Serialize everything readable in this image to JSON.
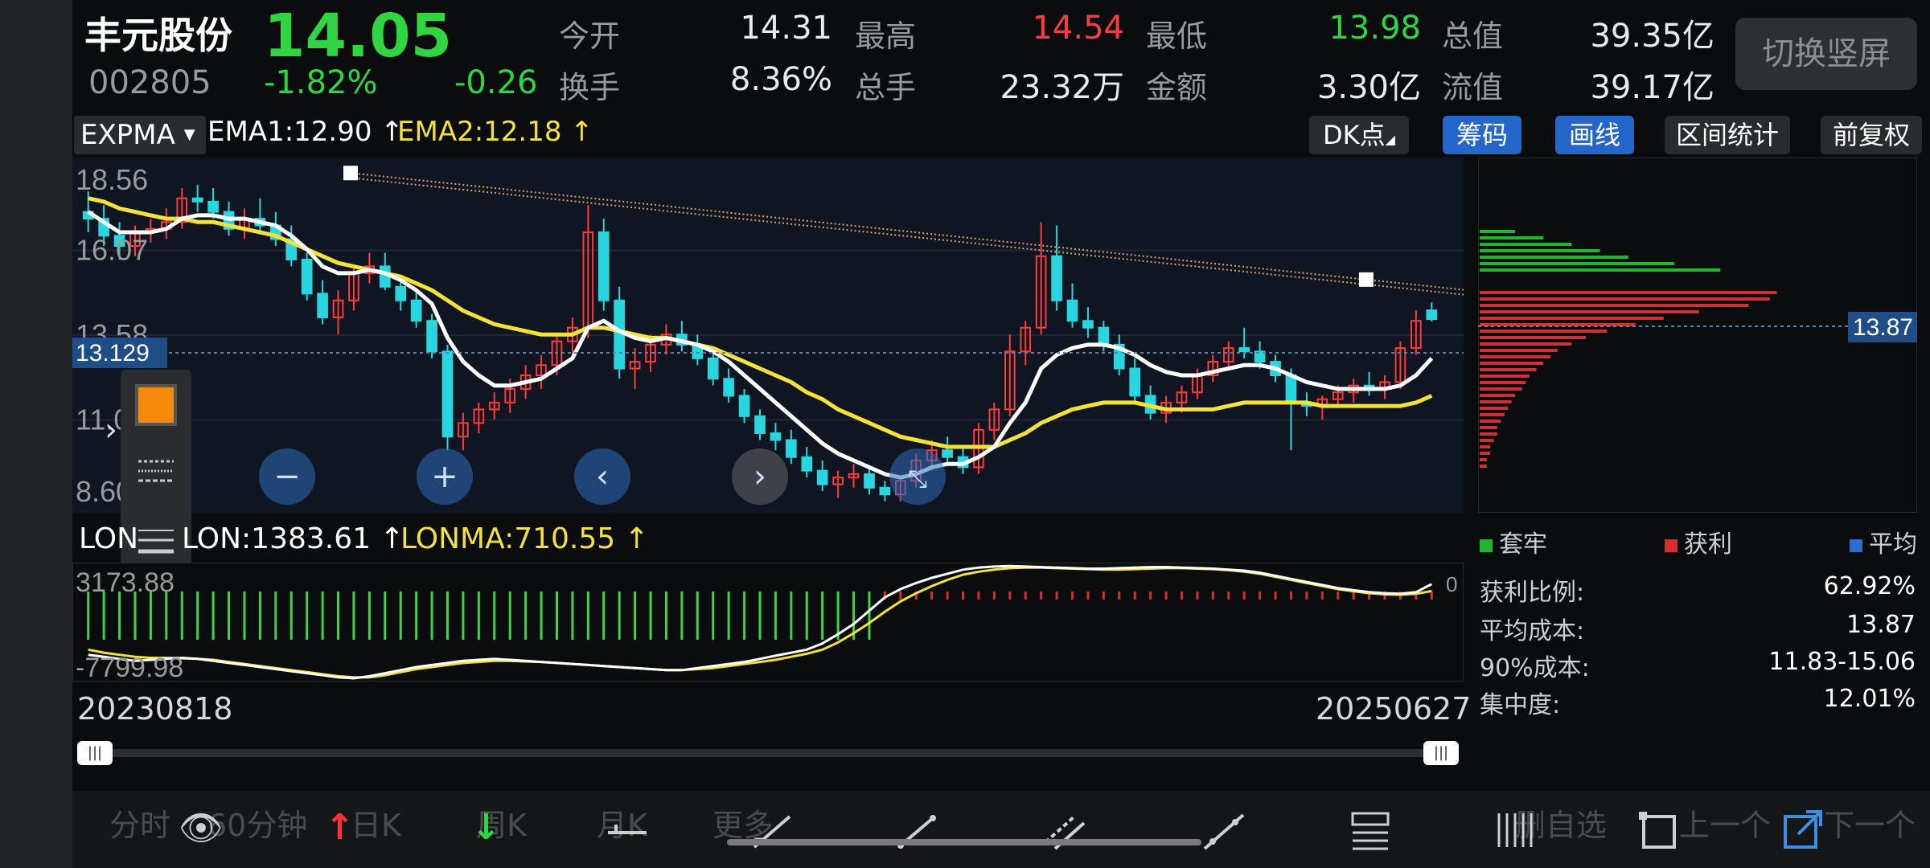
{
  "quote": {
    "name": "丰元股份",
    "code": "002805",
    "price": "14.05",
    "change_pct": "-1.82%",
    "change": "-0.26"
  },
  "stats": [
    {
      "label": "今开",
      "value": "14.31",
      "color": "#eaeaea"
    },
    {
      "label": "最高",
      "value": "14.54",
      "color": "#ff3b3b"
    },
    {
      "label": "最低",
      "value": "13.98",
      "color": "#2fd642"
    },
    {
      "label": "总值",
      "value": "39.35亿",
      "color": "#eaeaea"
    },
    {
      "label": "换手",
      "value": "8.36%",
      "color": "#eaeaea"
    },
    {
      "label": "总手",
      "value": "23.32万",
      "color": "#eaeaea"
    },
    {
      "label": "金额",
      "value": "3.30亿",
      "color": "#eaeaea"
    },
    {
      "label": "流值",
      "value": "39.17亿",
      "color": "#eaeaea"
    }
  ],
  "switch_button": "切换竖屏",
  "indicator": {
    "name": "EXPMA",
    "ema1": "EMA1:12.90 ↑",
    "ema2": "EMA2:12.18 ↑"
  },
  "toolbar": {
    "dk": "DK点",
    "chips": "筹码",
    "draw": "画线",
    "range": "区间统计",
    "adjust": "前复权"
  },
  "main_chart": {
    "y_labels": [
      "18.56",
      "16.07",
      "13.58",
      "11.09",
      "8.60"
    ],
    "current_line_label": "13.129"
  },
  "sub_indicator": {
    "name": "LON",
    "lon": "LON:1383.61 ↑",
    "lonma": "LONMA:710.55 ↑",
    "y_top": "3173.88",
    "y_bottom": "-7799.98",
    "zero": "0"
  },
  "dates": {
    "start": "20230818",
    "end": "20250627"
  },
  "chip_panel": {
    "price_label": "13.87",
    "legend": [
      {
        "label": "套牢",
        "color": "#21b52f"
      },
      {
        "label": "获利",
        "color": "#d2302f"
      },
      {
        "label": "平均",
        "color": "#2d6fd1"
      }
    ],
    "stats": [
      {
        "label": "获利比例:",
        "value": "62.92%"
      },
      {
        "label": "平均成本:",
        "value": "13.87"
      },
      {
        "label": "90%成本:",
        "value": "11.83-15.06"
      },
      {
        "label": "集中度:",
        "value": "12.01%"
      }
    ]
  },
  "bottom_tabs_ghost": [
    "分时",
    "60分钟",
    "日K",
    "周K",
    "月K",
    "更多",
    "删自选",
    "上一个",
    "下一个"
  ],
  "chart_data": {
    "type": "candlestick",
    "ylim": [
      8.6,
      18.56
    ],
    "ohlc_approx": [
      [
        17.2,
        17.8,
        16.6,
        17.0
      ],
      [
        17.0,
        17.4,
        16.2,
        16.5
      ],
      [
        16.5,
        16.9,
        15.8,
        16.2
      ],
      [
        16.2,
        16.8,
        15.9,
        16.6
      ],
      [
        16.6,
        17.0,
        16.3,
        16.7
      ],
      [
        16.7,
        17.3,
        16.4,
        16.9
      ],
      [
        16.9,
        17.9,
        16.7,
        17.6
      ],
      [
        17.6,
        18.0,
        17.2,
        17.5
      ],
      [
        17.5,
        17.9,
        17.0,
        17.2
      ],
      [
        17.2,
        17.5,
        16.5,
        16.7
      ],
      [
        16.7,
        17.3,
        16.4,
        17.0
      ],
      [
        17.0,
        17.6,
        16.6,
        16.8
      ],
      [
        16.8,
        17.2,
        16.2,
        16.4
      ],
      [
        16.4,
        16.8,
        15.6,
        15.8
      ],
      [
        15.8,
        16.0,
        14.6,
        14.8
      ],
      [
        14.8,
        15.2,
        13.9,
        14.1
      ],
      [
        14.1,
        14.9,
        13.6,
        14.6
      ],
      [
        14.6,
        15.6,
        14.3,
        15.4
      ],
      [
        15.4,
        16.0,
        15.1,
        15.6
      ],
      [
        15.6,
        16.0,
        14.9,
        15.0
      ],
      [
        15.0,
        15.3,
        14.3,
        14.6
      ],
      [
        14.6,
        14.9,
        13.8,
        14.0
      ],
      [
        14.0,
        14.2,
        12.9,
        13.1
      ],
      [
        13.1,
        13.3,
        10.2,
        10.6
      ],
      [
        10.6,
        11.3,
        10.2,
        11.0
      ],
      [
        11.0,
        11.6,
        10.7,
        11.4
      ],
      [
        11.4,
        11.9,
        11.1,
        11.6
      ],
      [
        11.6,
        12.3,
        11.3,
        12.0
      ],
      [
        12.0,
        12.7,
        11.7,
        12.4
      ],
      [
        12.4,
        13.0,
        12.0,
        12.7
      ],
      [
        12.7,
        13.6,
        12.4,
        13.4
      ],
      [
        13.4,
        14.1,
        13.0,
        13.8
      ],
      [
        13.8,
        17.4,
        13.5,
        16.6
      ],
      [
        16.6,
        17.0,
        14.3,
        14.6
      ],
      [
        14.6,
        15.0,
        12.3,
        12.6
      ],
      [
        12.6,
        13.2,
        12.0,
        12.8
      ],
      [
        12.8,
        13.6,
        12.5,
        13.3
      ],
      [
        13.3,
        13.9,
        13.0,
        13.6
      ],
      [
        13.6,
        14.0,
        13.1,
        13.3
      ],
      [
        13.3,
        13.6,
        12.7,
        12.9
      ],
      [
        12.9,
        13.1,
        12.1,
        12.3
      ],
      [
        12.3,
        12.6,
        11.6,
        11.8
      ],
      [
        11.8,
        12.0,
        11.0,
        11.2
      ],
      [
        11.2,
        11.4,
        10.5,
        10.7
      ],
      [
        10.7,
        11.0,
        10.2,
        10.5
      ],
      [
        10.5,
        10.8,
        9.8,
        10.0
      ],
      [
        10.0,
        10.3,
        9.4,
        9.6
      ],
      [
        9.6,
        9.9,
        9.0,
        9.2
      ],
      [
        9.2,
        9.6,
        8.8,
        9.4
      ],
      [
        9.4,
        9.8,
        9.1,
        9.5
      ],
      [
        9.5,
        9.7,
        8.9,
        9.1
      ],
      [
        9.1,
        9.3,
        8.7,
        8.9
      ],
      [
        8.9,
        9.4,
        8.7,
        9.3
      ],
      [
        9.3,
        10.1,
        9.1,
        9.9
      ],
      [
        9.9,
        10.5,
        9.6,
        10.2
      ],
      [
        10.2,
        10.6,
        9.8,
        10.0
      ],
      [
        10.0,
        10.3,
        9.5,
        9.7
      ],
      [
        9.7,
        11.0,
        9.5,
        10.8
      ],
      [
        10.8,
        11.6,
        10.5,
        11.4
      ],
      [
        11.4,
        13.6,
        11.2,
        13.1
      ],
      [
        13.1,
        14.0,
        12.7,
        13.8
      ],
      [
        13.8,
        16.9,
        13.6,
        15.9
      ],
      [
        15.9,
        16.8,
        14.3,
        14.6
      ],
      [
        14.6,
        15.1,
        13.8,
        14.0
      ],
      [
        14.0,
        14.4,
        13.5,
        13.8
      ],
      [
        13.8,
        14.0,
        13.1,
        13.3
      ],
      [
        13.3,
        13.6,
        12.4,
        12.6
      ],
      [
        12.6,
        12.9,
        11.6,
        11.8
      ],
      [
        11.8,
        12.1,
        11.1,
        11.3
      ],
      [
        11.3,
        11.8,
        11.0,
        11.6
      ],
      [
        11.6,
        12.1,
        11.3,
        11.9
      ],
      [
        11.9,
        12.6,
        11.7,
        12.4
      ],
      [
        12.4,
        13.0,
        12.2,
        12.8
      ],
      [
        12.8,
        13.4,
        12.6,
        13.2
      ],
      [
        13.2,
        13.8,
        12.9,
        13.1
      ],
      [
        13.1,
        13.4,
        12.6,
        12.8
      ],
      [
        12.8,
        13.0,
        12.2,
        12.4
      ],
      [
        12.4,
        12.6,
        10.2,
        11.6
      ],
      [
        11.6,
        11.9,
        11.2,
        11.5
      ],
      [
        11.5,
        11.8,
        11.1,
        11.7
      ],
      [
        11.7,
        12.1,
        11.5,
        11.9
      ],
      [
        11.9,
        12.3,
        11.6,
        12.1
      ],
      [
        12.1,
        12.5,
        11.8,
        12.0
      ],
      [
        12.0,
        12.4,
        11.7,
        12.2
      ],
      [
        12.2,
        13.4,
        12.0,
        13.2
      ],
      [
        13.2,
        14.3,
        13.0,
        14.0
      ],
      [
        14.31,
        14.54,
        13.98,
        14.05
      ]
    ],
    "ema1_approx": [
      17.2,
      16.9,
      16.6,
      16.6,
      16.6,
      16.7,
      17.0,
      17.1,
      17.1,
      17.0,
      17.0,
      16.9,
      16.8,
      16.5,
      16.1,
      15.6,
      15.4,
      15.4,
      15.5,
      15.4,
      15.2,
      14.9,
      14.5,
      13.5,
      12.8,
      12.4,
      12.1,
      12.1,
      12.2,
      12.3,
      12.6,
      12.9,
      13.8,
      14.0,
      13.7,
      13.5,
      13.4,
      13.5,
      13.4,
      13.3,
      13.1,
      12.8,
      12.4,
      12.0,
      11.6,
      11.2,
      10.8,
      10.4,
      10.1,
      9.9,
      9.7,
      9.5,
      9.4,
      9.5,
      9.7,
      9.8,
      9.8,
      10.0,
      10.3,
      11.0,
      11.6,
      12.6,
      13.0,
      13.2,
      13.3,
      13.3,
      13.2,
      13.0,
      12.7,
      12.5,
      12.4,
      12.4,
      12.5,
      12.6,
      12.7,
      12.7,
      12.6,
      12.4,
      12.2,
      12.1,
      12.0,
      12.0,
      12.0,
      12.0,
      12.1,
      12.4,
      12.9
    ],
    "ema2_approx": [
      17.6,
      17.5,
      17.3,
      17.2,
      17.1,
      17.0,
      17.0,
      16.9,
      16.9,
      16.8,
      16.7,
      16.6,
      16.5,
      16.3,
      16.1,
      15.9,
      15.7,
      15.6,
      15.5,
      15.4,
      15.3,
      15.1,
      14.9,
      14.6,
      14.3,
      14.1,
      13.9,
      13.8,
      13.7,
      13.6,
      13.6,
      13.6,
      13.8,
      13.8,
      13.7,
      13.6,
      13.5,
      13.5,
      13.4,
      13.3,
      13.2,
      13.0,
      12.8,
      12.6,
      12.4,
      12.2,
      11.9,
      11.7,
      11.4,
      11.2,
      11.0,
      10.8,
      10.6,
      10.5,
      10.4,
      10.3,
      10.3,
      10.3,
      10.3,
      10.5,
      10.7,
      11.0,
      11.2,
      11.4,
      11.5,
      11.6,
      11.6,
      11.6,
      11.5,
      11.4,
      11.4,
      11.4,
      11.4,
      11.5,
      11.6,
      11.6,
      11.6,
      11.6,
      11.6,
      11.5,
      11.5,
      11.5,
      11.5,
      11.5,
      11.5,
      11.6,
      11.8
    ],
    "trendline": {
      "from": [
        0.2,
        0.03
      ],
      "to": [
        0.93,
        0.33
      ]
    }
  },
  "sub_chart_data": {
    "type": "bar+line",
    "ylim": [
      -7799.98,
      3173.88
    ],
    "lon_approx": [
      -5500,
      -5700,
      -5900,
      -6100,
      -6000,
      -5900,
      -5800,
      -5900,
      -6100,
      -6300,
      -6500,
      -6700,
      -6900,
      -7100,
      -7300,
      -7500,
      -7700,
      -7800,
      -7600,
      -7300,
      -7000,
      -6700,
      -6500,
      -6300,
      -6100,
      -6000,
      -5900,
      -6000,
      -6100,
      -6200,
      -6300,
      -6400,
      -6500,
      -6600,
      -6700,
      -6800,
      -6900,
      -7000,
      -7000,
      -6800,
      -6600,
      -6400,
      -6200,
      -5900,
      -5600,
      -5300,
      -5000,
      -4400,
      -3500,
      -2500,
      -1200,
      100,
      900,
      1500,
      2000,
      2400,
      2800,
      3000,
      3100,
      3150,
      3100,
      3050,
      3000,
      2950,
      2900,
      2900,
      2950,
      3000,
      3050,
      3050,
      3000,
      2950,
      2900,
      2800,
      2700,
      2500,
      2200,
      1900,
      1600,
      1300,
      1000,
      800,
      600,
      500,
      450,
      600,
      1383
    ],
    "lonma_approx": [
      -5000,
      -5300,
      -5500,
      -5700,
      -5800,
      -5800,
      -5850,
      -5900,
      -6000,
      -6200,
      -6400,
      -6600,
      -6800,
      -7000,
      -7200,
      -7400,
      -7600,
      -7700,
      -7700,
      -7500,
      -7200,
      -6900,
      -6700,
      -6500,
      -6300,
      -6200,
      -6100,
      -6100,
      -6150,
      -6200,
      -6300,
      -6400,
      -6500,
      -6600,
      -6700,
      -6800,
      -6900,
      -7000,
      -7000,
      -6900,
      -6800,
      -6600,
      -6400,
      -6200,
      -6000,
      -5700,
      -5400,
      -5000,
      -4300,
      -3400,
      -2400,
      -1300,
      -300,
      500,
      1200,
      1800,
      2300,
      2600,
      2800,
      2950,
      3000,
      3000,
      2950,
      2900,
      2850,
      2800,
      2800,
      2850,
      2900,
      2950,
      2950,
      2900,
      2850,
      2750,
      2600,
      2400,
      2100,
      1800,
      1500,
      1200,
      900,
      700,
      500,
      400,
      350,
      450,
      710
    ]
  }
}
